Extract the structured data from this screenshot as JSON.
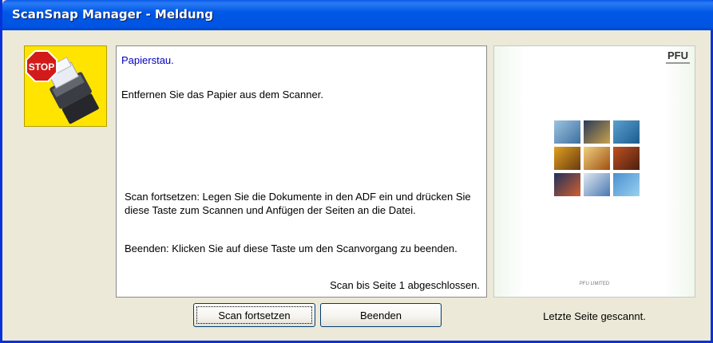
{
  "window": {
    "title": "ScanSnap Manager - Meldung"
  },
  "icon": {
    "name": "stop-scanner-icon",
    "sign_text": "STOP",
    "colors": {
      "background": "#ffe400",
      "sign": "#d21a1a"
    }
  },
  "message": {
    "title": "Papierstau.",
    "body": "Entfernen Sie das Papier aus dem Scanner.",
    "continue_help": "Scan fortsetzen: Legen Sie die Dokumente in den ADF ein  und drücken Sie diese Taste zum Scannen und Anfügen der Seiten an die Datei.",
    "quit_help": "Beenden: Klicken Sie auf diese Taste um den Scanvorgang zu beenden.",
    "progress": "Scan bis Seite 1 abgeschlossen."
  },
  "preview": {
    "logo": "PFU",
    "footer": "PFU LIMITED"
  },
  "buttons": {
    "continue_label": "Scan fortsetzen",
    "quit_label": "Beenden"
  },
  "status": {
    "text": "Letzte Seite gescannt."
  },
  "colors": {
    "titlebar": "#0054e3",
    "dialog_bg": "#ece9d8",
    "message_title": "#0000c0"
  }
}
